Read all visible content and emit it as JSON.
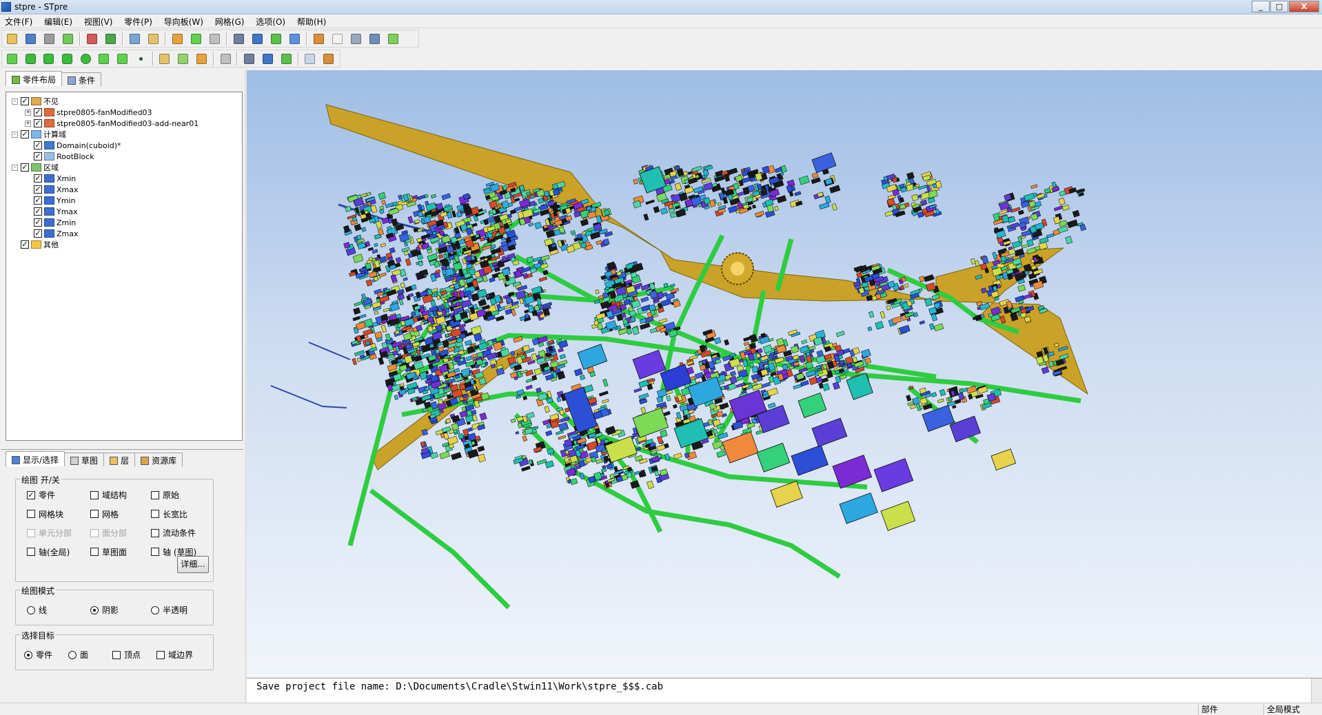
{
  "window": {
    "title": "stpre - STpre",
    "min": "_",
    "max": "□",
    "close": "X"
  },
  "menu": [
    "文件(F)",
    "编辑(E)",
    "视图(V)",
    "零件(P)",
    "导向板(W)",
    "网格(G)",
    "选项(O)",
    "帮助(H)"
  ],
  "toolbar1": [
    "new-file-icon",
    "copy-file-icon",
    "save-icon",
    "export-icon",
    "|",
    "part-color-icon",
    "paint-brush-icon",
    "|",
    "undo-icon",
    "redo-icon",
    "|",
    "select-icon",
    "select-box-icon",
    "measure-icon",
    "|",
    "move-icon",
    "rotate-icon",
    "mesh-icon",
    "report-icon",
    "|",
    "cut-icon",
    "wrench-icon",
    "grid-icon",
    "folder-icon",
    "layers-icon"
  ],
  "toolbar2": [
    "box-icon",
    "cylinder-open-icon",
    "cylinder-icon",
    "cone-icon",
    "sphere-icon",
    "plane-icon",
    "polygon-icon",
    "point-icon",
    "|",
    "fan-icon",
    "fan-multi-icon",
    "probe-icon",
    "|",
    "delete-icon",
    "|",
    "view-copy-icon",
    "view-link-icon",
    "list-icon",
    "|",
    "chart-icon",
    "analysis-icon"
  ],
  "tree_tabs": [
    "零件布局",
    "条件"
  ],
  "tree": [
    {
      "level": 0,
      "exp": "-",
      "checked": true,
      "label": "不见",
      "icon": "group-icon",
      "color": "#e0a94b"
    },
    {
      "level": 1,
      "exp": "+",
      "checked": true,
      "label": "stpre0805-fanModified03",
      "icon": "assembly-icon",
      "color": "#e36a3a"
    },
    {
      "level": 1,
      "exp": "+",
      "checked": true,
      "label": "stpre0805-fanModified03-add-near01",
      "icon": "assembly-icon",
      "color": "#e36a3a"
    },
    {
      "level": 0,
      "exp": "-",
      "checked": true,
      "label": "计算域",
      "icon": "group-icon",
      "color": "#7fb6e8"
    },
    {
      "level": 1,
      "exp": "",
      "checked": true,
      "label": "Domain(cuboid)*",
      "icon": "domain-icon",
      "color": "#3d7bd6"
    },
    {
      "level": 1,
      "exp": "",
      "checked": true,
      "label": "RootBlock",
      "icon": "block-icon",
      "color": "#9ac0ea"
    },
    {
      "level": 0,
      "exp": "-",
      "checked": true,
      "label": "区域",
      "icon": "group-icon",
      "color": "#7fc36b"
    },
    {
      "level": 1,
      "exp": "",
      "checked": true,
      "label": "Xmin",
      "icon": "face-icon",
      "color": "#3c6fd1"
    },
    {
      "level": 1,
      "exp": "",
      "checked": true,
      "label": "Xmax",
      "icon": "face-icon",
      "color": "#3c6fd1"
    },
    {
      "level": 1,
      "exp": "",
      "checked": true,
      "label": "Ymin",
      "icon": "face-icon",
      "color": "#3c6fd1"
    },
    {
      "level": 1,
      "exp": "",
      "checked": true,
      "label": "Ymax",
      "icon": "face-icon",
      "color": "#3c6fd1"
    },
    {
      "level": 1,
      "exp": "",
      "checked": true,
      "label": "Zmin",
      "icon": "face-icon",
      "color": "#3c6fd1"
    },
    {
      "level": 1,
      "exp": "",
      "checked": true,
      "label": "Zmax",
      "icon": "face-icon",
      "color": "#3c6fd1"
    },
    {
      "level": 0,
      "exp": "",
      "checked": true,
      "label": "其他",
      "icon": "misc-icon",
      "color": "#f2c744"
    }
  ],
  "lower_tabs": [
    "显示/选择",
    "草图",
    "层",
    "资源库"
  ],
  "draw_toggle": {
    "title": "绘图 开/关",
    "options": [
      {
        "label": "零件",
        "checked": true,
        "disabled": false
      },
      {
        "label": "域结构",
        "checked": false,
        "disabled": false
      },
      {
        "label": "原始",
        "checked": false,
        "disabled": false
      },
      {
        "label": "网格块",
        "checked": false,
        "disabled": false
      },
      {
        "label": "网格",
        "checked": false,
        "disabled": false
      },
      {
        "label": "长宽比",
        "checked": false,
        "disabled": false
      },
      {
        "label": "单元分部",
        "checked": false,
        "disabled": true
      },
      {
        "label": "面分部",
        "checked": false,
        "disabled": true
      },
      {
        "label": "流动条件",
        "checked": false,
        "disabled": false
      },
      {
        "label": "轴(全局)",
        "checked": false,
        "disabled": false
      },
      {
        "label": "草图面",
        "checked": false,
        "disabled": false
      },
      {
        "label": "轴 (草图)",
        "checked": false,
        "disabled": false
      }
    ],
    "detail_button": "详细..."
  },
  "draw_mode": {
    "title": "绘图模式",
    "options": [
      {
        "label": "线",
        "selected": false
      },
      {
        "label": "阴影",
        "selected": true
      },
      {
        "label": "半透明",
        "selected": false
      }
    ]
  },
  "select_target": {
    "title": "选择目标",
    "options": [
      {
        "label": "零件",
        "type": "radio",
        "selected": true
      },
      {
        "label": "面",
        "type": "radio",
        "selected": false
      },
      {
        "label": "顶点",
        "type": "check",
        "selected": false
      },
      {
        "label": "域边界",
        "type": "check",
        "selected": false
      }
    ]
  },
  "console": {
    "text": "Save project file name: D:\\Documents\\Cradle\\Stwin11\\Work\\stpre_$$$.cab"
  },
  "status": {
    "mode1": "部件",
    "mode2": "全局模式"
  },
  "colors": {
    "river": "#c9a227",
    "road": "#2ecc40",
    "bg_top": "#9fbde4",
    "bg_bottom": "#f1f5fb"
  }
}
